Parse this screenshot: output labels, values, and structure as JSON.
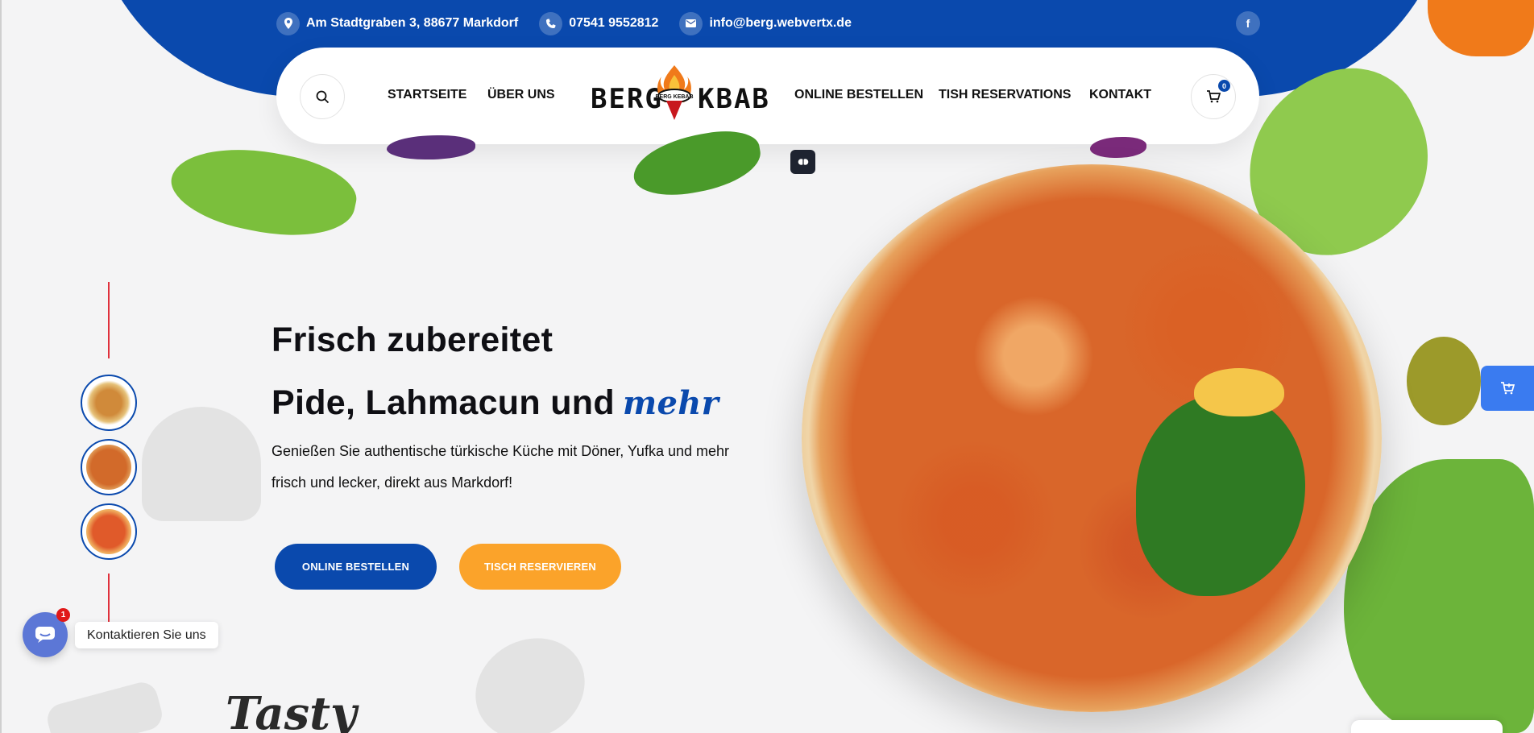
{
  "topbar": {
    "address": "Am Stadtgraben 3, 88677 Markdorf",
    "phone": "07541 9552812",
    "email": "info@berg.webvertx.de",
    "facebook_glyph": "f",
    "icons": [
      "location-pin-icon",
      "phone-icon",
      "mail-icon",
      "facebook-icon"
    ]
  },
  "nav": {
    "left_links": [
      "STARTSEITE",
      "ÜBER UNS"
    ],
    "right_links": [
      "ONLINE BESTELLEN",
      "TISH RESERVATIONS",
      "KONTAKT"
    ],
    "logo_left": "BERG",
    "logo_right": "KBAB",
    "logo_badge": "BERG KEBAB",
    "cart_count": "0"
  },
  "hero": {
    "line1": "Frisch zubereitet",
    "line2": "Pide, Lahmacun und",
    "accent": "mehr",
    "subtitle_line1": "Genießen Sie authentische türkische Küche mit Döner, Yufka und mehr",
    "subtitle_line2": "frisch und lecker, direkt aus Markdorf!",
    "btn_order": "ONLINE BESTELLEN",
    "btn_reserve": "TISCH RESERVIEREN"
  },
  "contact": {
    "label": "Kontaktieren Sie uns",
    "badge": "1"
  },
  "bottom": {
    "script_word": "Tasty"
  },
  "colors": {
    "brand_blue": "#0a49ad",
    "accent_orange": "#fba32a",
    "accent_red": "#e0313c"
  }
}
